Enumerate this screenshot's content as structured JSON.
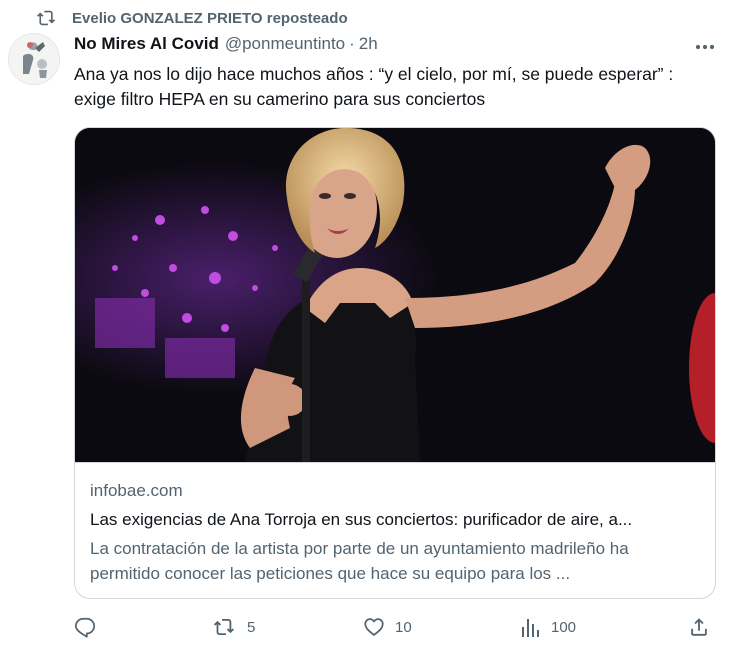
{
  "repost": {
    "icon": "repost-icon",
    "text": "Evelio GONZALEZ PRIETO reposteado"
  },
  "author": {
    "name": "No Mires Al Covid",
    "handle": "@ponmeuntinto",
    "separator": "·",
    "time": "2h"
  },
  "tweet": {
    "text": "Ana ya nos lo dijo hace muchos años : “y el cielo, por mí, se puede esperar” : exige filtro HEPA en su camerino para sus conciertos"
  },
  "card": {
    "domain": "infobae.com",
    "title": "Las exigencias de Ana Torroja en sus conciertos: purificador de aire, a...",
    "description": "La contratación de la artista por parte de un ayuntamiento madrileño ha permitido conocer las peticiones que hace su equipo para los ..."
  },
  "actions": {
    "reply": {
      "icon": "reply-icon",
      "count": ""
    },
    "repost": {
      "icon": "repost-icon",
      "count": "5"
    },
    "like": {
      "icon": "heart-icon",
      "count": "10"
    },
    "views": {
      "icon": "views-icon",
      "count": "100"
    },
    "share": {
      "icon": "share-icon",
      "count": ""
    }
  },
  "colors": {
    "text": "#0f1419",
    "secondary": "#536471",
    "border": "#cfd9de"
  }
}
